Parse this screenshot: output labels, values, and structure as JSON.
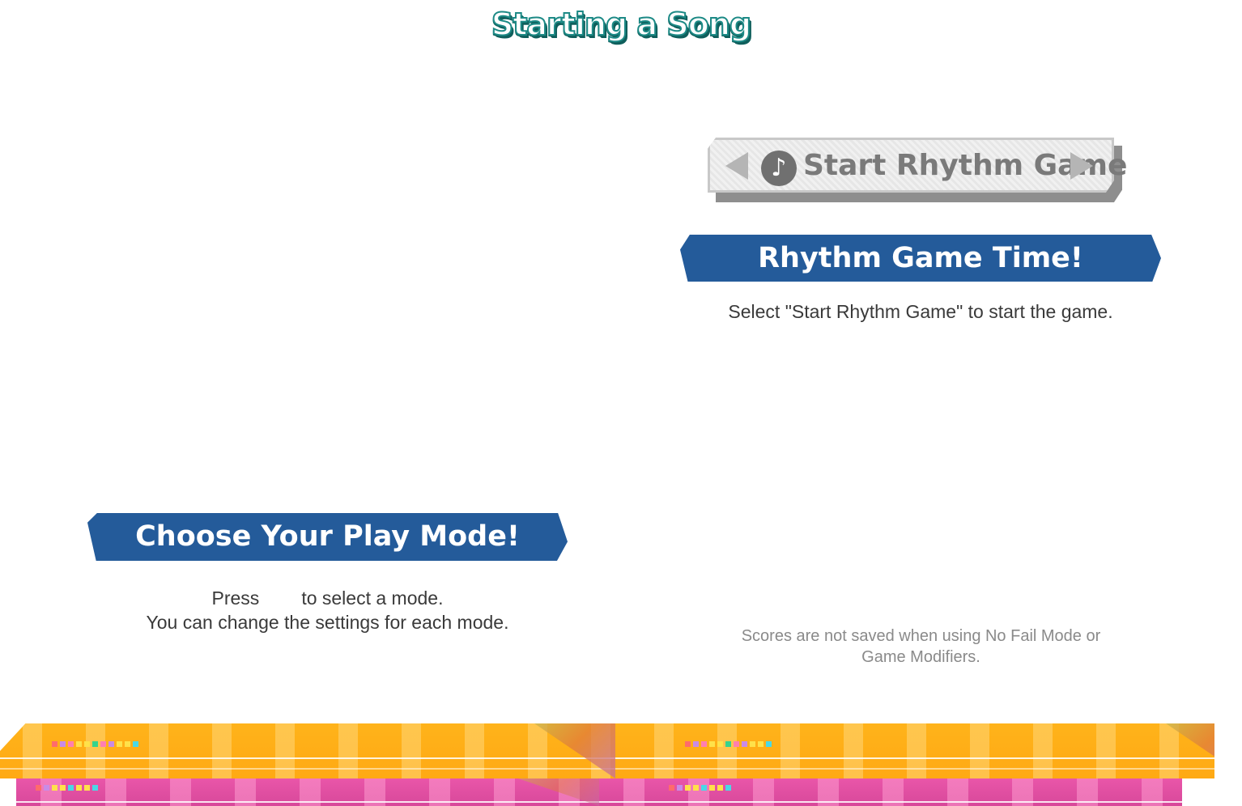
{
  "page_title": "Starting a Song",
  "start_button": {
    "label": "Start Rhythm Game",
    "icon": "music-note-icon"
  },
  "rhythm_section": {
    "heading": "Rhythm Game Time!",
    "description": "Select \"Start Rhythm Game\" to start the game."
  },
  "mode_section": {
    "heading": "Choose Your Play Mode!",
    "line1_prefix": "Press",
    "line1_suffix": "to select a mode.",
    "line2": "You can change the settings for each mode."
  },
  "note": {
    "line1": "Scores are not saved when using No Fail Mode or",
    "line2": "Game Modifiers."
  },
  "colors": {
    "title_outline": "#1d8a86",
    "banner": "#245b9a",
    "strip_orange": "#ffb31a",
    "strip_pink": "#e956a9"
  }
}
